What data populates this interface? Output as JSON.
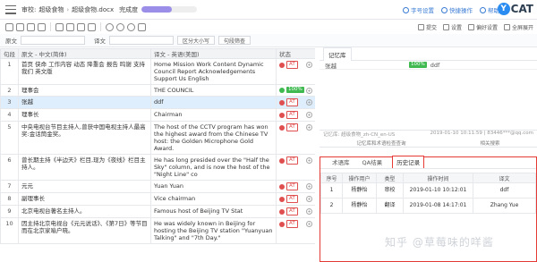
{
  "topbar": {
    "crumbs": [
      "审校:",
      "超级食物",
      "超级食物.docx"
    ],
    "progress_label": "完成度",
    "progress_value": 0.55,
    "right_items": [
      "字号设置",
      "快捷操作",
      "帮助"
    ],
    "logo_text": "CAT",
    "logo_letter": "Y"
  },
  "toolbar": {
    "right_items": [
      "提交",
      "设置",
      "偏好设置",
      "全屏展开"
    ]
  },
  "filter": {
    "source_label": "原文",
    "target_label": "译文",
    "case_button": "区分大小写",
    "search_button": "句段筛查"
  },
  "grid": {
    "headers": [
      "句段",
      "原文 - 中文(简体)",
      "译文 - 英语(美国)",
      "状态"
    ],
    "rows": [
      {
        "num": "1",
        "source": "首页 侠命 工作内容 动态 降重会 报告 鸣谢 支持 我们 英文版",
        "target": "Home Mission Work Content Dynamic Council Report Acknowledgements Support Us English",
        "badge": "AT",
        "selected": false
      },
      {
        "num": "2",
        "source": "理事会",
        "target": "THE COUNCIL",
        "badge": "100%",
        "selected": false
      },
      {
        "num": "3",
        "source": "张越",
        "target": "ddf",
        "badge": "AT",
        "selected": true
      },
      {
        "num": "4",
        "source": "理事长",
        "target": "Chairman",
        "badge": "AT",
        "selected": false
      },
      {
        "num": "5",
        "source": "中央电视台节目主持人,曾获中国电视主持人最高奖:金话筒金奖。",
        "target": "The host of the CCTV program has won the highest award from the Chinese TV host: the Golden Microphone Gold Award.",
        "badge": "AT",
        "selected": false
      },
      {
        "num": "6",
        "source": "曾长期主持《半边天》栏目,现为《夜线》栏目主持人。",
        "target": "He has long presided over the \"Half the Sky\" column, and is now the host of the \"Night Line\" co",
        "badge": "AT",
        "selected": false
      },
      {
        "num": "7",
        "source": "元元",
        "target": "Yuan Yuan",
        "badge": "AT",
        "selected": false
      },
      {
        "num": "8",
        "source": "副理事长",
        "target": "Vice chairman",
        "badge": "AT",
        "selected": false
      },
      {
        "num": "9",
        "source": "北京电视台著名主持人。",
        "target": "Famous host of Beijing TV Stat",
        "badge": "AT",
        "selected": false
      },
      {
        "num": "10",
        "source": "因主持北京电视台《元元说话》、《第7日》等节目而在北京家喻户晓。",
        "target": "He was widely known in Beijing for hosting the Beijing TV station \"Yuanyuan Talking\" and \"7th Day.\"",
        "badge": "AT",
        "selected": false
      }
    ]
  },
  "tm": {
    "tab_label": "记忆库",
    "match_source": "张越",
    "match_percent": "100%",
    "match_target": "ddf",
    "meta_left": "记忆库: 超级食物_zh-CN_en-US",
    "meta_right": "2019-01-10 10:11:59 | 83446***@qq.com",
    "links": [
      "记忆库和术语检查查询",
      "相关搜索"
    ]
  },
  "history": {
    "tabs": [
      "术语库",
      "QA结果",
      "历史记录"
    ],
    "active_tab": "历史记录",
    "headers": [
      "序号",
      "操作用户",
      "类型",
      "操作时间",
      "译文"
    ],
    "rows": [
      [
        "1",
        "杨静怡",
        "审校",
        "2019-01-10 10:12:01",
        "ddf"
      ],
      [
        "2",
        "杨静怡",
        "翻译",
        "2019-01-08 14:17:01",
        "Zhang Yue"
      ]
    ]
  },
  "watermark": "知乎 @草莓味的咩酱"
}
